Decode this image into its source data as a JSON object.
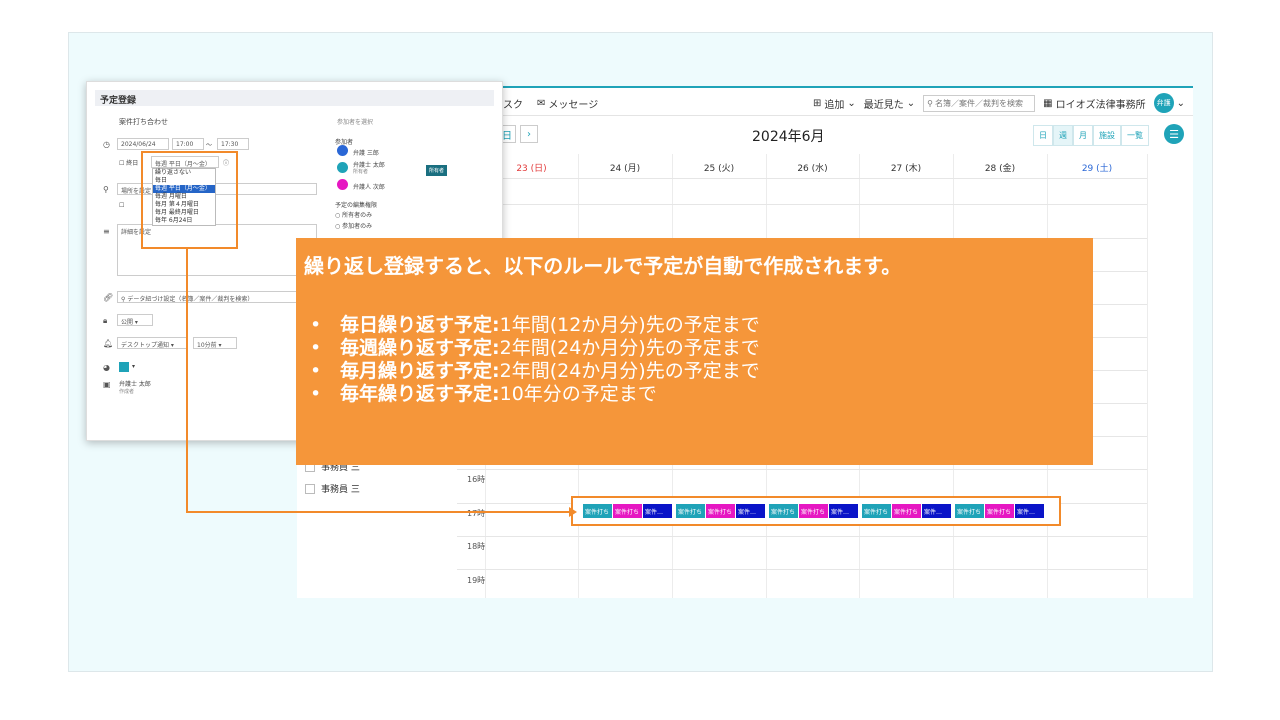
{
  "topbar": {
    "task": "スク",
    "message": "メッセージ",
    "add": "追加",
    "recent": "最近見た",
    "search_placeholder": "名簿／案件／裁判を検索",
    "office": "ロイオズ法律事務所",
    "avatar": "弁護"
  },
  "calendar": {
    "title": "2024年6月",
    "today_label": "日",
    "views": [
      "日",
      "週",
      "月",
      "施設",
      "一覧"
    ],
    "days": [
      {
        "label": "23 (日)",
        "color": "#e23b3b"
      },
      {
        "label": "24 (月)",
        "color": "#333333"
      },
      {
        "label": "25 (火)",
        "color": "#333333"
      },
      {
        "label": "26 (水)",
        "color": "#333333"
      },
      {
        "label": "27 (木)",
        "color": "#333333"
      },
      {
        "label": "28 (金)",
        "color": "#333333"
      },
      {
        "label": "29 (土)",
        "color": "#2a67d6"
      }
    ],
    "times": [
      "16時",
      "17時",
      "18時",
      "19時"
    ],
    "staff": [
      "事務員 三"
    ],
    "events": [
      {
        "label": "案件打ち",
        "color": "#1fa3b8"
      },
      {
        "label": "案件打ち",
        "color": "#e617c2"
      },
      {
        "label": "案件…",
        "color": "#0a14c8"
      }
    ]
  },
  "dialog": {
    "title": "予定登録",
    "event_name": "案件打ち合わせ",
    "date": "2024/06/24",
    "start_time": "17:00",
    "tilde": "～",
    "end_time": "17:30",
    "allday": "終日",
    "repeat_value": "毎週 平日（月～金）",
    "repeat_options": [
      "繰り返さない",
      "毎日",
      "毎週 平日（月～金）",
      "毎週 月曜日",
      "毎月 第４月曜日",
      "毎月 最終月曜日",
      "毎年 6月24日"
    ],
    "place_placeholder": "場所を設定",
    "detail_placeholder": "詳細を設定",
    "link_placeholder": "データ紐づけ設定（名簿／案件／裁判を検索）",
    "visibility": "公開",
    "notify": "デスクトップ通知",
    "notify_time": "10分前",
    "creator": "弁護士 太郎",
    "creator_role": "作成者",
    "participants_label": "参加者を選択",
    "participants_heading": "参加者",
    "participants": [
      {
        "name": "弁護 三郎",
        "color": "#2a67d6",
        "initial": "弁護"
      },
      {
        "name": "弁護士 太郎",
        "sub": "所有者",
        "color": "#1fa3b8",
        "initial": "弁護"
      },
      {
        "name": "弁護人 次郎",
        "color": "#e617c2",
        "initial": "弁護"
      }
    ],
    "owner_badge": "所有者",
    "edit_perm_heading": "予定の編集権限",
    "edit_perm_options": [
      "所有者のみ",
      "参加者のみ"
    ]
  },
  "callout": {
    "heading": "繰り返し登録すると、以下のルールで予定が自動で作成されます。",
    "rules": [
      {
        "bullet": "•",
        "label": "毎日繰り返す予定:",
        "text": "1年間(12か月分)先の予定まで"
      },
      {
        "bullet": "•",
        "label": "毎週繰り返す予定:",
        "text": "2年間(24か月分)先の予定まで"
      },
      {
        "bullet": "•",
        "label": "毎月繰り返す予定:",
        "text": "2年間(24か月分)先の予定まで"
      },
      {
        "bullet": "•",
        "label": "毎年繰り返す予定:",
        "text": "10年分の予定まで"
      }
    ]
  },
  "colors": {
    "accent": "#1fa3b8",
    "callout": "#f5963a",
    "highlight": "#f28a2a"
  }
}
